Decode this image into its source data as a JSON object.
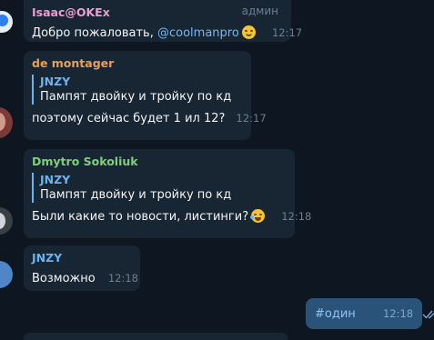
{
  "messages": [
    {
      "sender": "Isaac@OKEx",
      "sender_color": "#e9a0cf",
      "badge": "админ",
      "text_prefix": "Добро пожаловать, ",
      "mention": "@coolmanpro",
      "emoji": "wink-emoji",
      "time": "12:17"
    },
    {
      "sender": "de montager",
      "sender_color": "#e6a05a",
      "reply": {
        "name": "JNZY",
        "text": "Пампят двойку и тройку по кд"
      },
      "text": "поэтому сейчас будет 1 ил 12?",
      "time": "12:17"
    },
    {
      "sender": "Dmytro Sokoliuk",
      "sender_color": "#7fd07a",
      "reply": {
        "name": "JNZY",
        "text": "Пампят двойку и тройку по кд"
      },
      "text": "Были какие то новости, листинги?",
      "emoji": "laugh-emoji",
      "time": "12:18"
    },
    {
      "sender": "JNZY",
      "sender_color": "#6ab3f3",
      "text": "Возможно",
      "time": "12:18"
    },
    {
      "outgoing": true,
      "text": "#один",
      "time": "12:18",
      "status_icon": "double-check-icon"
    }
  ],
  "colors": {
    "background": "#0e1621",
    "incoming_bubble": "#182533",
    "outgoing_bubble": "#2b5278",
    "link": "#71baf5"
  }
}
